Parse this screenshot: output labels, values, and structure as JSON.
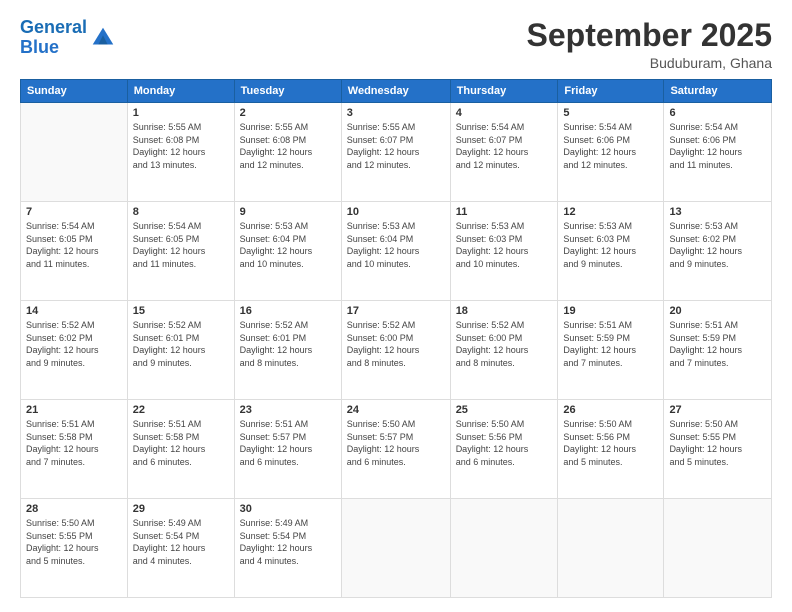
{
  "logo": {
    "text1": "General",
    "text2": "Blue"
  },
  "header": {
    "month": "September 2025",
    "location": "Buduburam, Ghana"
  },
  "days": [
    "Sunday",
    "Monday",
    "Tuesday",
    "Wednesday",
    "Thursday",
    "Friday",
    "Saturday"
  ],
  "weeks": [
    [
      {
        "num": "",
        "info": ""
      },
      {
        "num": "1",
        "info": "Sunrise: 5:55 AM\nSunset: 6:08 PM\nDaylight: 12 hours\nand 13 minutes."
      },
      {
        "num": "2",
        "info": "Sunrise: 5:55 AM\nSunset: 6:08 PM\nDaylight: 12 hours\nand 12 minutes."
      },
      {
        "num": "3",
        "info": "Sunrise: 5:55 AM\nSunset: 6:07 PM\nDaylight: 12 hours\nand 12 minutes."
      },
      {
        "num": "4",
        "info": "Sunrise: 5:54 AM\nSunset: 6:07 PM\nDaylight: 12 hours\nand 12 minutes."
      },
      {
        "num": "5",
        "info": "Sunrise: 5:54 AM\nSunset: 6:06 PM\nDaylight: 12 hours\nand 12 minutes."
      },
      {
        "num": "6",
        "info": "Sunrise: 5:54 AM\nSunset: 6:06 PM\nDaylight: 12 hours\nand 11 minutes."
      }
    ],
    [
      {
        "num": "7",
        "info": "Sunrise: 5:54 AM\nSunset: 6:05 PM\nDaylight: 12 hours\nand 11 minutes."
      },
      {
        "num": "8",
        "info": "Sunrise: 5:54 AM\nSunset: 6:05 PM\nDaylight: 12 hours\nand 11 minutes."
      },
      {
        "num": "9",
        "info": "Sunrise: 5:53 AM\nSunset: 6:04 PM\nDaylight: 12 hours\nand 10 minutes."
      },
      {
        "num": "10",
        "info": "Sunrise: 5:53 AM\nSunset: 6:04 PM\nDaylight: 12 hours\nand 10 minutes."
      },
      {
        "num": "11",
        "info": "Sunrise: 5:53 AM\nSunset: 6:03 PM\nDaylight: 12 hours\nand 10 minutes."
      },
      {
        "num": "12",
        "info": "Sunrise: 5:53 AM\nSunset: 6:03 PM\nDaylight: 12 hours\nand 9 minutes."
      },
      {
        "num": "13",
        "info": "Sunrise: 5:53 AM\nSunset: 6:02 PM\nDaylight: 12 hours\nand 9 minutes."
      }
    ],
    [
      {
        "num": "14",
        "info": "Sunrise: 5:52 AM\nSunset: 6:02 PM\nDaylight: 12 hours\nand 9 minutes."
      },
      {
        "num": "15",
        "info": "Sunrise: 5:52 AM\nSunset: 6:01 PM\nDaylight: 12 hours\nand 9 minutes."
      },
      {
        "num": "16",
        "info": "Sunrise: 5:52 AM\nSunset: 6:01 PM\nDaylight: 12 hours\nand 8 minutes."
      },
      {
        "num": "17",
        "info": "Sunrise: 5:52 AM\nSunset: 6:00 PM\nDaylight: 12 hours\nand 8 minutes."
      },
      {
        "num": "18",
        "info": "Sunrise: 5:52 AM\nSunset: 6:00 PM\nDaylight: 12 hours\nand 8 minutes."
      },
      {
        "num": "19",
        "info": "Sunrise: 5:51 AM\nSunset: 5:59 PM\nDaylight: 12 hours\nand 7 minutes."
      },
      {
        "num": "20",
        "info": "Sunrise: 5:51 AM\nSunset: 5:59 PM\nDaylight: 12 hours\nand 7 minutes."
      }
    ],
    [
      {
        "num": "21",
        "info": "Sunrise: 5:51 AM\nSunset: 5:58 PM\nDaylight: 12 hours\nand 7 minutes."
      },
      {
        "num": "22",
        "info": "Sunrise: 5:51 AM\nSunset: 5:58 PM\nDaylight: 12 hours\nand 6 minutes."
      },
      {
        "num": "23",
        "info": "Sunrise: 5:51 AM\nSunset: 5:57 PM\nDaylight: 12 hours\nand 6 minutes."
      },
      {
        "num": "24",
        "info": "Sunrise: 5:50 AM\nSunset: 5:57 PM\nDaylight: 12 hours\nand 6 minutes."
      },
      {
        "num": "25",
        "info": "Sunrise: 5:50 AM\nSunset: 5:56 PM\nDaylight: 12 hours\nand 6 minutes."
      },
      {
        "num": "26",
        "info": "Sunrise: 5:50 AM\nSunset: 5:56 PM\nDaylight: 12 hours\nand 5 minutes."
      },
      {
        "num": "27",
        "info": "Sunrise: 5:50 AM\nSunset: 5:55 PM\nDaylight: 12 hours\nand 5 minutes."
      }
    ],
    [
      {
        "num": "28",
        "info": "Sunrise: 5:50 AM\nSunset: 5:55 PM\nDaylight: 12 hours\nand 5 minutes."
      },
      {
        "num": "29",
        "info": "Sunrise: 5:49 AM\nSunset: 5:54 PM\nDaylight: 12 hours\nand 4 minutes."
      },
      {
        "num": "30",
        "info": "Sunrise: 5:49 AM\nSunset: 5:54 PM\nDaylight: 12 hours\nand 4 minutes."
      },
      {
        "num": "",
        "info": ""
      },
      {
        "num": "",
        "info": ""
      },
      {
        "num": "",
        "info": ""
      },
      {
        "num": "",
        "info": ""
      }
    ]
  ]
}
